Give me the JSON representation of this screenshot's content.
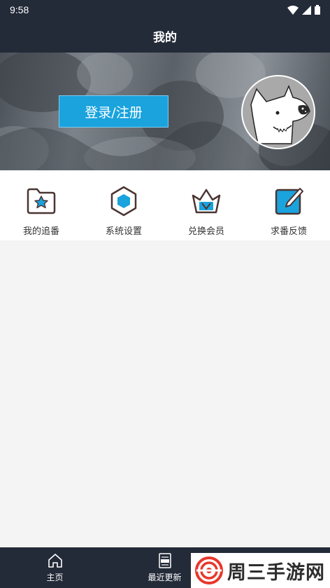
{
  "status_bar": {
    "time": "9:58"
  },
  "header": {
    "title": "我的"
  },
  "banner": {
    "login_label": "登录/注册"
  },
  "menu": {
    "items": [
      {
        "label": "我的追番",
        "icon": "folder-star-icon"
      },
      {
        "label": "系统设置",
        "icon": "hexagon-settings-icon"
      },
      {
        "label": "兑换会员",
        "icon": "crown-vip-icon"
      },
      {
        "label": "求番反馈",
        "icon": "edit-feedback-icon"
      }
    ]
  },
  "bottom_nav": {
    "items": [
      {
        "label": "主页",
        "icon": "home-icon"
      },
      {
        "label": "最近更新",
        "icon": "new-updates-icon"
      }
    ]
  },
  "watermark": {
    "text": "周三手游网"
  },
  "colors": {
    "header_bg": "#232a38",
    "accent_blue": "#1aa3dd",
    "icon_outline": "#4a3533",
    "page_bg": "#f4f4f4"
  }
}
